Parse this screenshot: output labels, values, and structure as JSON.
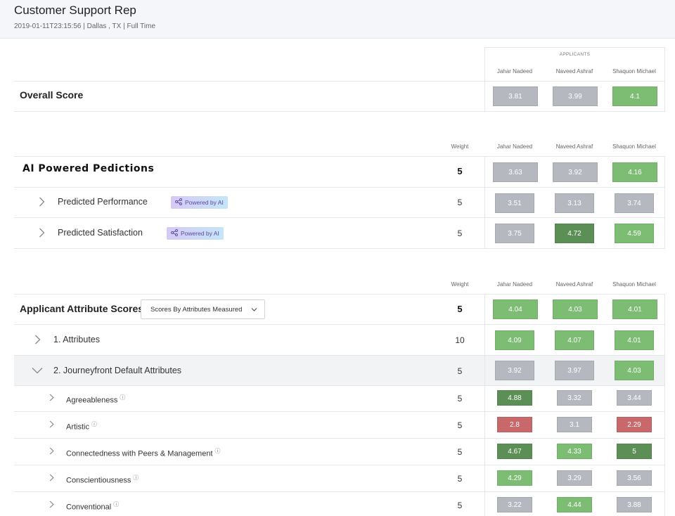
{
  "header": {
    "title": "Customer Support Rep",
    "meta": "2019-01-11T23:15:56 | Dallas , TX | Full Time"
  },
  "colors": {
    "grey": "#b5b9bf",
    "green": "#7cbd73",
    "dark_green": "#5c8f56",
    "red": "#c9686a",
    "header_bg": "#f4f6f9"
  },
  "overall": {
    "caption": "APPLICANTS",
    "applicants": [
      "Jahar Nadeed",
      "Naveed Ashraf",
      "Shaquon Michael"
    ],
    "label": "Overall Score",
    "scores": [
      {
        "value": "3.81",
        "color": "grey"
      },
      {
        "value": "3.99",
        "color": "grey"
      },
      {
        "value": "4.1",
        "color": "green"
      }
    ]
  },
  "ai": {
    "weight_header": "Weight",
    "applicants": [
      "Jahar Nadeed",
      "Naveed Ashraf",
      "Shaquon Michael"
    ],
    "title": "AI Powered Pedictions",
    "weight": "5",
    "scores": [
      {
        "value": "3.63",
        "color": "grey"
      },
      {
        "value": "3.92",
        "color": "grey"
      },
      {
        "value": "4.16",
        "color": "green"
      }
    ],
    "badge": "Powered by AI",
    "rows": [
      {
        "label": "Predicted Performance",
        "weight": "5",
        "scores": [
          {
            "value": "3.51",
            "color": "grey"
          },
          {
            "value": "3.13",
            "color": "grey"
          },
          {
            "value": "3.74",
            "color": "grey"
          }
        ]
      },
      {
        "label": "Predicted Satisfaction",
        "weight": "5",
        "scores": [
          {
            "value": "3.75",
            "color": "grey"
          },
          {
            "value": "4.72",
            "color": "dark_green"
          },
          {
            "value": "4.59",
            "color": "green"
          }
        ]
      }
    ]
  },
  "attr": {
    "weight_header": "Weight",
    "applicants": [
      "Jahar Nadeed",
      "Naveed Ashraf",
      "Shaquon Michael"
    ],
    "title": "Applicant Attribute Scores",
    "dropdown": "Scores By Attributes Measured",
    "weight": "5",
    "scores": [
      {
        "value": "4.04",
        "color": "green"
      },
      {
        "value": "4.03",
        "color": "green"
      },
      {
        "value": "4.01",
        "color": "green"
      }
    ],
    "groups": [
      {
        "label": "1. Attributes",
        "weight": "10",
        "scores": [
          {
            "value": "4.09",
            "color": "green"
          },
          {
            "value": "4.07",
            "color": "green"
          },
          {
            "value": "4.01",
            "color": "green"
          }
        ]
      },
      {
        "label": "2. Journeyfront Default Attributes",
        "weight": "5",
        "scores": [
          {
            "value": "3.92",
            "color": "grey"
          },
          {
            "value": "3.97",
            "color": "grey"
          },
          {
            "value": "4.03",
            "color": "green"
          }
        ]
      }
    ],
    "items": [
      {
        "label": "Agreeableness",
        "weight": "5",
        "scores": [
          {
            "value": "4.88",
            "color": "dark_green"
          },
          {
            "value": "3.32",
            "color": "grey"
          },
          {
            "value": "3.44",
            "color": "grey"
          }
        ]
      },
      {
        "label": "Artistic",
        "weight": "5",
        "scores": [
          {
            "value": "2.8",
            "color": "red"
          },
          {
            "value": "3.1",
            "color": "grey"
          },
          {
            "value": "2.29",
            "color": "red"
          }
        ]
      },
      {
        "label": "Connectedness with Peers & Management",
        "weight": "5",
        "scores": [
          {
            "value": "4.67",
            "color": "dark_green"
          },
          {
            "value": "4.33",
            "color": "green"
          },
          {
            "value": "5",
            "color": "dark_green"
          }
        ]
      },
      {
        "label": "Conscientiousness",
        "weight": "5",
        "scores": [
          {
            "value": "4.29",
            "color": "green"
          },
          {
            "value": "3.29",
            "color": "grey"
          },
          {
            "value": "3.56",
            "color": "grey"
          }
        ]
      },
      {
        "label": "Conventional",
        "weight": "5",
        "scores": [
          {
            "value": "3.22",
            "color": "grey"
          },
          {
            "value": "4.44",
            "color": "green"
          },
          {
            "value": "3.88",
            "color": "grey"
          }
        ]
      }
    ]
  }
}
